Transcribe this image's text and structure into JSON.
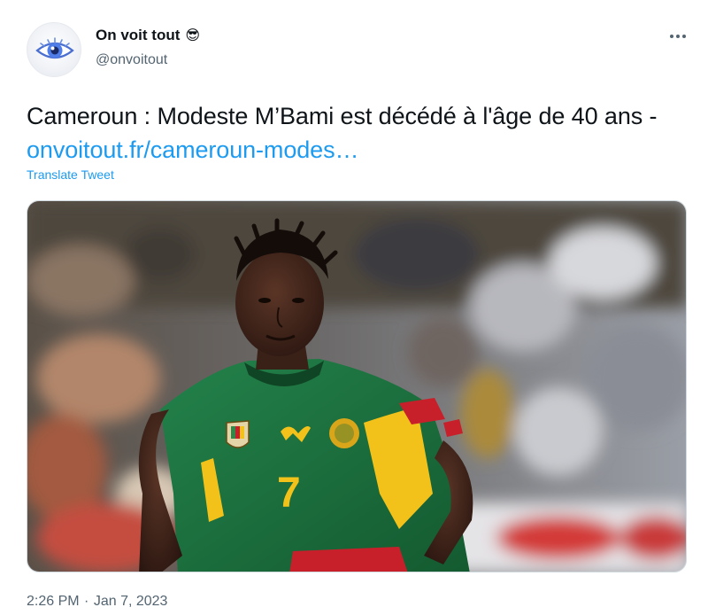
{
  "author": {
    "display_name": "On voit tout",
    "name_emoji": "😎",
    "handle": "@onvoitout",
    "avatar_icon": "eye-icon"
  },
  "menu": {
    "more_icon": "more-horizontal-icon"
  },
  "tweet": {
    "text": "Cameroun : Modeste M’Bami est décédé à l'âge de 40 ans - ",
    "link_text": "onvoitout.fr/cameroun-modes…",
    "translate_label": "Translate Tweet",
    "time": "2:26 PM",
    "separator": "·",
    "date": "Jan 7, 2023"
  },
  "media": {
    "jersey_number": "7",
    "colors": {
      "jersey_green": "#1e6b3a",
      "jersey_yellow": "#f2c21b",
      "shorts_red": "#c8202b"
    }
  },
  "colors": {
    "accent": "#1d9bf0",
    "text": "#0f1419",
    "secondary": "#536471"
  }
}
